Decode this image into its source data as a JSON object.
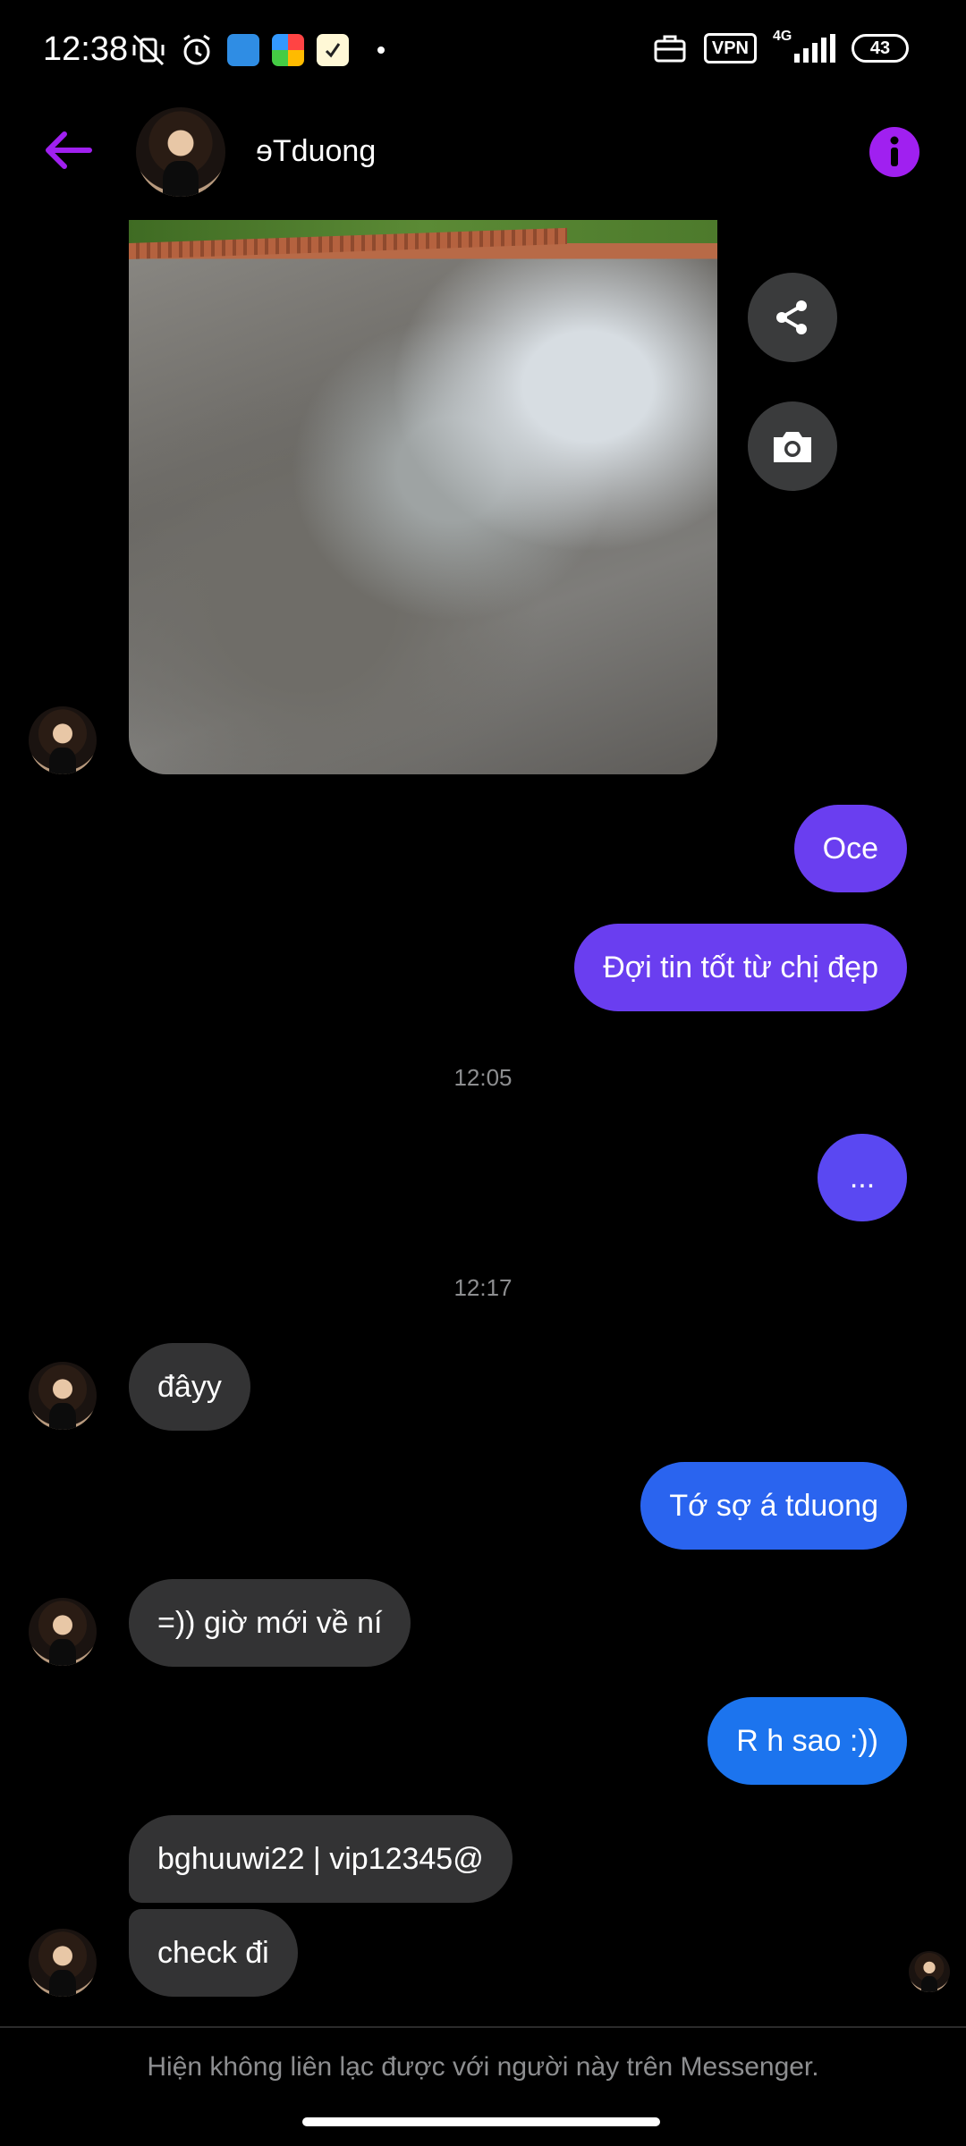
{
  "status_bar": {
    "time": "12:38",
    "vpn": "VPN",
    "network": "4G",
    "battery": "43"
  },
  "header": {
    "contact_name": "ɘTduong",
    "accent_color": "#a020f0"
  },
  "messages": [
    {
      "type": "in_image",
      "description": "wet pavement photo"
    },
    {
      "type": "out",
      "text": "Oce",
      "color": "#6a3ef0"
    },
    {
      "type": "out",
      "text": "Đợi tin tốt từ chị đẹp",
      "color": "#6a3ef0"
    },
    {
      "type": "timestamp",
      "text": "12:05"
    },
    {
      "type": "out",
      "text": "...",
      "color": "#5a48f2"
    },
    {
      "type": "timestamp",
      "text": "12:17"
    },
    {
      "type": "in",
      "text": "đâyy"
    },
    {
      "type": "out",
      "text": "Tớ sợ á tduong",
      "color": "#2a64ef"
    },
    {
      "type": "in",
      "text": "=)) giờ mới về ní"
    },
    {
      "type": "out",
      "text": "R h sao :))",
      "color": "#1c74ee"
    },
    {
      "type": "in",
      "text": "bghuuwi22 | vip12345@"
    },
    {
      "type": "in",
      "text": "check đi"
    }
  ],
  "footer": {
    "note": "Hiện không liên lạc được với người này trên Messenger."
  }
}
